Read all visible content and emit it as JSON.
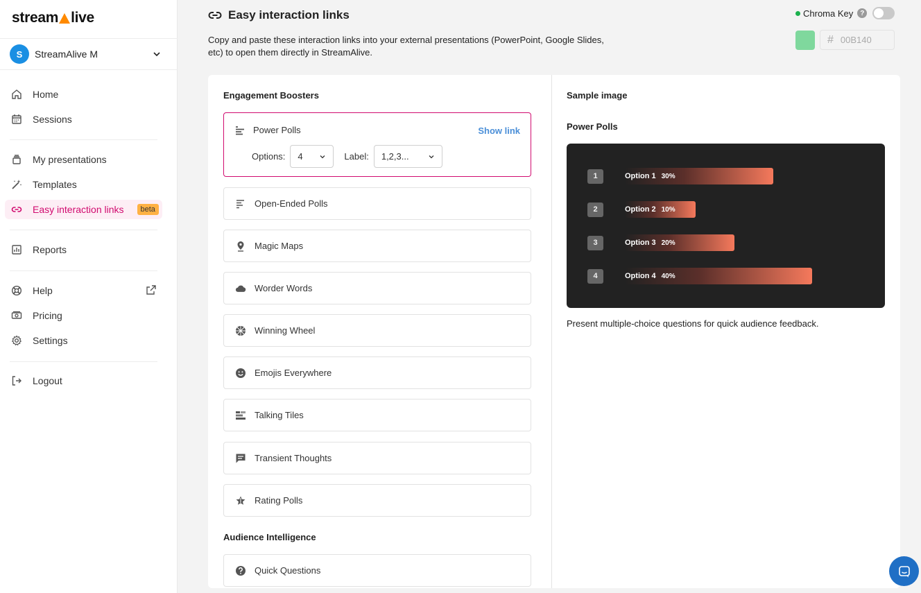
{
  "brand": {
    "logo_prefix": "stream",
    "logo_suffix": "live"
  },
  "account": {
    "initial": "S",
    "name": "StreamAlive M"
  },
  "nav": {
    "home": "Home",
    "sessions": "Sessions",
    "my_presentations": "My presentations",
    "templates": "Templates",
    "easy_links": "Easy interaction links",
    "easy_links_badge": "beta",
    "reports": "Reports",
    "help": "Help",
    "pricing": "Pricing",
    "settings": "Settings",
    "logout": "Logout"
  },
  "header": {
    "title": "Easy interaction links",
    "description": "Copy and paste these interaction links into your external presentations (PowerPoint, Google Slides, etc) to open them directly in StreamAlive.",
    "chroma_label": "Chroma Key",
    "chroma_enabled": false,
    "color_value": "00B140",
    "hash_symbol": "#"
  },
  "left": {
    "section1_title": "Engagement Boosters",
    "selected_tool": {
      "name": "Power Polls",
      "show_link": "Show link",
      "options_label": "Options:",
      "options_value": "4",
      "label_label": "Label:",
      "label_value": "1,2,3..."
    },
    "tools": [
      "Open-Ended Polls",
      "Magic Maps",
      "Worder Words",
      "Winning Wheel",
      "Emojis Everywhere",
      "Talking Tiles",
      "Transient Thoughts",
      "Rating Polls"
    ],
    "section2_title": "Audience Intelligence",
    "tools2": [
      "Quick Questions"
    ]
  },
  "right": {
    "sample_title": "Sample image",
    "tool_name": "Power Polls",
    "preview": [
      {
        "num": "1",
        "label": "Option 1",
        "pct": "30%",
        "value": 30
      },
      {
        "num": "2",
        "label": "Option 2",
        "pct": "10%",
        "value": 10
      },
      {
        "num": "3",
        "label": "Option 3",
        "pct": "20%",
        "value": 20
      },
      {
        "num": "4",
        "label": "Option 4",
        "pct": "40%",
        "value": 40
      }
    ],
    "description": "Present multiple-choice questions for quick audience feedback."
  },
  "colors": {
    "accent": "#d10a6f",
    "link": "#4b8fd8",
    "badge": "#ffb144",
    "swatch": "#7fd89d"
  }
}
